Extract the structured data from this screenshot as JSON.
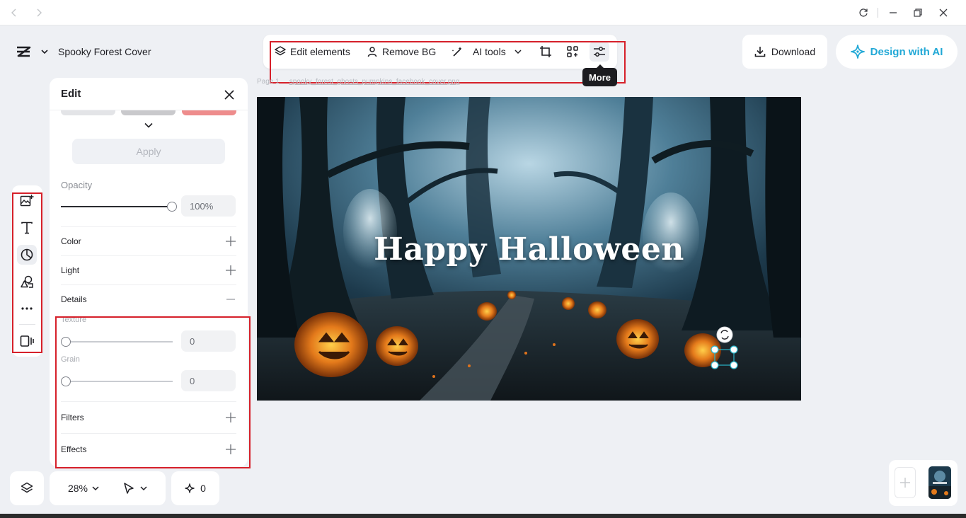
{
  "window": {
    "controls": [
      "back-icon",
      "forward-icon",
      "refresh-icon",
      "minimize-icon",
      "restore-icon",
      "close-icon"
    ]
  },
  "document": {
    "title": "Spooky Forest Cover"
  },
  "toolbar": {
    "edit_elements": "Edit elements",
    "remove_bg": "Remove BG",
    "ai_tools": "AI tools",
    "tooltip": "More"
  },
  "actions": {
    "download": "Download",
    "design_ai": "Design with AI"
  },
  "colors": {
    "accent": "#21a8d6",
    "highlight_box": "#d6202a"
  },
  "panel": {
    "title": "Edit",
    "apply": "Apply",
    "opacity": {
      "label": "Opacity",
      "value": "100%",
      "level": 1.0
    },
    "sections": {
      "color": "Color",
      "light": "Light",
      "details": "Details",
      "filters": "Filters",
      "effects": "Effects"
    },
    "texture": {
      "label": "Texture",
      "value": "0",
      "level": 0
    },
    "grain": {
      "label": "Grain",
      "value": "0",
      "level": 0
    }
  },
  "canvas": {
    "page_label": "Page 1",
    "file_name": "spooky_forest_ghosts_pumpkins_facebook_cover.png",
    "headline": "Happy Halloween"
  },
  "bottom": {
    "zoom": "28%",
    "ai_count": "0"
  }
}
